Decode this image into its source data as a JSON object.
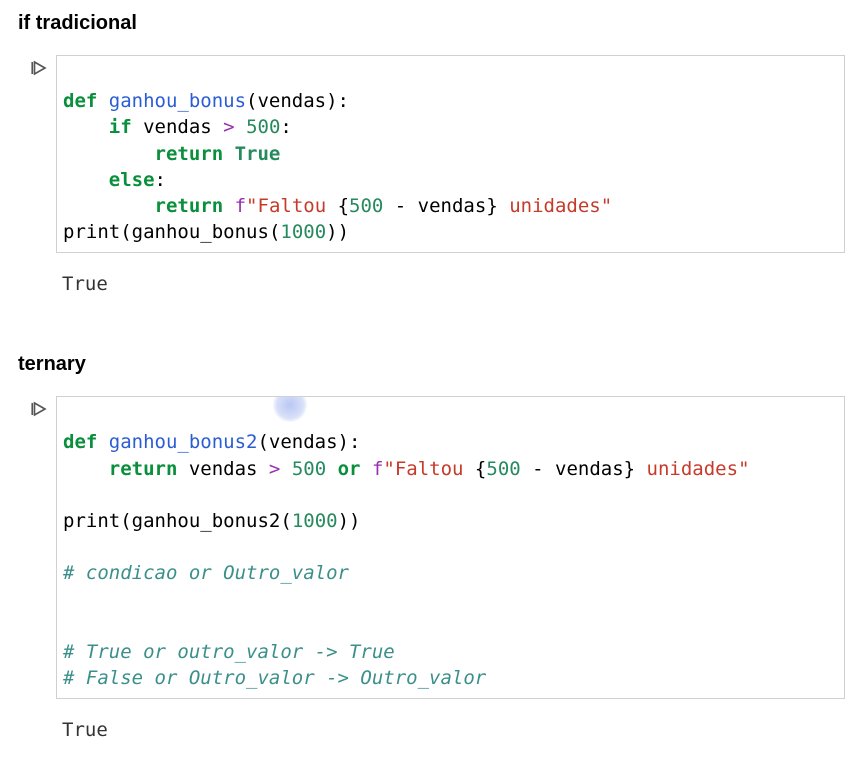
{
  "section1": {
    "heading": "if tradicional",
    "run_icon": "run-cell-icon",
    "code": {
      "l1": {
        "def": "def ",
        "fn": "ganhou_bonus",
        "rest": "(vendas):"
      },
      "l2": {
        "pad": "    ",
        "if": "if ",
        "var": "vendas ",
        "op": "> ",
        "num": "500",
        "colon": ":"
      },
      "l3": {
        "pad": "        ",
        "ret": "return ",
        "true": "True"
      },
      "l4": {
        "pad": "    ",
        "else": "else",
        "colon": ":"
      },
      "l5": {
        "pad": "        ",
        "ret": "return ",
        "f": "f",
        "q1": "\"",
        "s1": "Faltou ",
        "br1": "{",
        "n500": "500",
        "minus": " - vendas",
        "br2": "}",
        "s2": " unidades",
        "q2": "\""
      },
      "l6": {
        "print": "print",
        "open": "(",
        "fn": "ganhou_bonus",
        "open2": "(",
        "arg": "1000",
        "close": "))"
      }
    },
    "output": "True"
  },
  "section2": {
    "heading": "ternary",
    "run_icon": "run-cell-icon",
    "code": {
      "l1": {
        "def": "def ",
        "fn": "ganhou_bonus2",
        "rest": "(vendas):"
      },
      "l2": {
        "pad": "    ",
        "ret": "return ",
        "var": "vendas ",
        "op": "> ",
        "num": "500",
        "sp": " ",
        "or": "or",
        "sp2": " ",
        "f": "f",
        "q1": "\"",
        "s1": "Faltou ",
        "br1": "{",
        "n500": "500",
        "minus": " - vendas",
        "br2": "}",
        "s2": " unidades",
        "q2": "\""
      },
      "l3": "",
      "l4": {
        "print": "print",
        "open": "(",
        "fn": "ganhou_bonus2",
        "open2": "(",
        "arg": "1000",
        "close": "))"
      },
      "l5": "",
      "l6": {
        "c": "# condicao or Outro_valor"
      },
      "l7": "",
      "l8": "",
      "l9": {
        "c": "# True or outro_valor -> True"
      },
      "l10": {
        "c": "# False or Outro_valor -> Outro_valor"
      }
    },
    "output": "True"
  }
}
